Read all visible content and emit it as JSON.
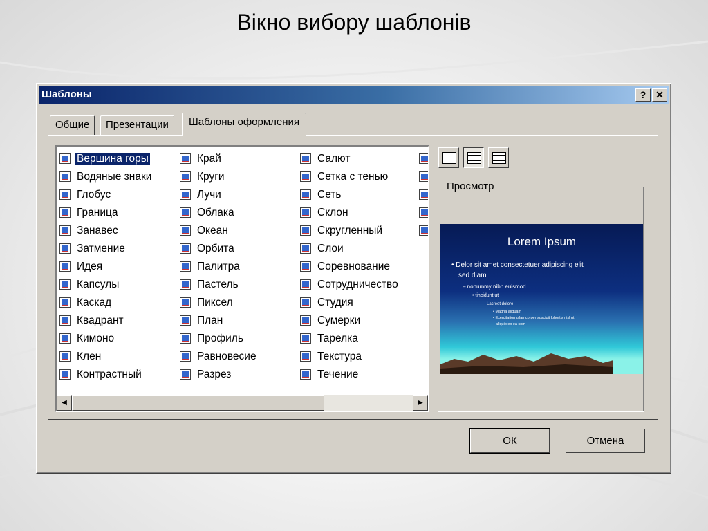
{
  "slide": {
    "title": "Вікно вибору шаблонів"
  },
  "dialog": {
    "title": "Шаблоны",
    "help_label": "?",
    "close_label": "✕",
    "tabs": [
      {
        "label": "Общие"
      },
      {
        "label": "Презентации"
      },
      {
        "label": "Шаблоны оформления",
        "active": true
      }
    ],
    "templates": {
      "col1": [
        "Вершина горы",
        "Водяные знаки",
        "Глобус",
        "Граница",
        "Занавес",
        "Затмение",
        "Идея",
        "Капсулы",
        "Каскад",
        "Квадрант",
        "Кимоно",
        "Клен",
        "Контрастный"
      ],
      "col2": [
        "Край",
        "Круги",
        "Лучи",
        "Облака",
        "Океан",
        "Орбита",
        "Палитра",
        "Пастель",
        "Пиксел",
        "План",
        "Профиль",
        "Равновесие",
        "Разрез"
      ],
      "col3": [
        "Салют",
        "Сетка с тенью",
        "Сеть",
        "Склон",
        "Скругленный",
        "Слои",
        "Соревнование",
        "Сотрудничество",
        "Студия",
        "Сумерки",
        "Тарелка",
        "Текстура",
        "Течение"
      ],
      "selected": "Вершина горы"
    },
    "preview": {
      "label": "Просмотр",
      "slide_title": "Lorem Ipsum",
      "bullets": [
        {
          "level": 1,
          "text": "• Delor sit amet consectetuer adipiscing elit"
        },
        {
          "level": 1,
          "text": "  sed diam"
        },
        {
          "level": 2,
          "text": "– nonummy nibh euismod"
        },
        {
          "level": 3,
          "text": "• tincidunt ut"
        },
        {
          "level": 4,
          "text": "– Lacreet dolore"
        },
        {
          "level": 5,
          "text": "• Magna aliquam"
        },
        {
          "level": 5,
          "text": "• Exercitation ullamcorper suscipit lobortis nisl ut"
        },
        {
          "level": 5,
          "text": "  aliquip ex ea com"
        }
      ]
    },
    "buttons": {
      "ok": "ОК",
      "cancel": "Отмена"
    }
  }
}
